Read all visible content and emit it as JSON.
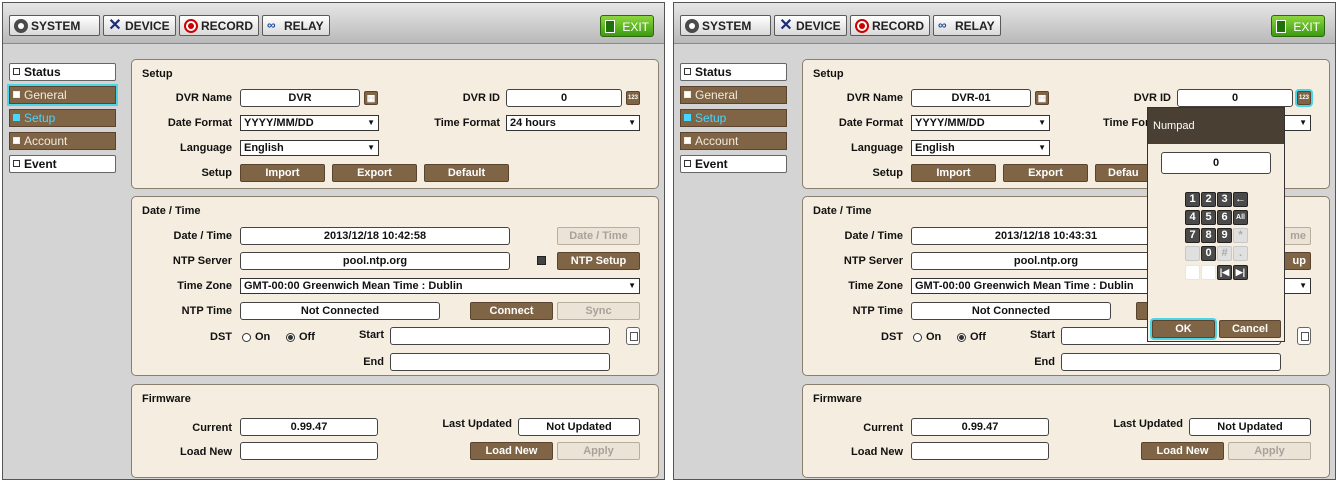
{
  "menu": {
    "system": "SYSTEM",
    "device": "DEVICE",
    "record": "RECORD",
    "relay": "RELAY",
    "exit": "EXIT"
  },
  "sidebar": {
    "status": "Status",
    "general": "General",
    "setup": "Setup",
    "account": "Account",
    "event": "Event"
  },
  "setup": {
    "title": "Setup",
    "dvr_name_label": "DVR Name",
    "dvr_id_label": "DVR ID",
    "date_format_label": "Date Format",
    "date_format_value": "YYYY/MM/DD",
    "time_format_label": "Time Format",
    "time_format_value": "24 hours",
    "language_label": "Language",
    "language_value": "English",
    "setup_label": "Setup",
    "import_button": "Import",
    "export_button": "Export",
    "default_button": "Default",
    "keyboard_icon_text": "123"
  },
  "datetime": {
    "title": "Date / Time",
    "date_time_label": "Date / Time",
    "date_time_button": "Date / Time",
    "ntp_server_label": "NTP Server",
    "ntp_server_value": "pool.ntp.org",
    "ntp_setup_button": "NTP Setup",
    "time_zone_label": "Time Zone",
    "time_zone_value": "GMT-00:00 Greenwich Mean Time : Dublin",
    "ntp_time_label": "NTP Time",
    "ntp_time_value": "Not Connected",
    "connect_button": "Connect",
    "sync_button": "Sync",
    "dst_label": "DST",
    "dst_on": "On",
    "dst_off": "Off",
    "start_label": "Start",
    "end_label": "End"
  },
  "firmware": {
    "title": "Firmware",
    "current_label": "Current",
    "current_value": "0.99.47",
    "last_updated_label": "Last Updated",
    "last_updated_value": "Not Updated",
    "load_new_label": "Load New",
    "load_new_button": "Load New",
    "apply_button": "Apply"
  },
  "left": {
    "dvr_name": "DVR",
    "dvr_id": "0",
    "date_time": "2013/12/18  10:42:58"
  },
  "right": {
    "dvr_name": "DVR-01",
    "dvr_id": "0",
    "date_time": "2013/12/18  10:43:31",
    "time_format_partial": "Time For",
    "default_partial": "Defau"
  },
  "numpad": {
    "title": "Numpad",
    "value": "0",
    "keys": [
      "1",
      "2",
      "3",
      "4",
      "5",
      "6",
      "7",
      "8",
      "9",
      "*",
      "0",
      "#",
      "."
    ],
    "backspace": "←",
    "all": "All",
    "ok": "OK",
    "cancel": "Cancel"
  },
  "colors": {
    "accent_brown": "#7f6446",
    "panel_bg": "#f5eddf",
    "highlight_cyan": "#4ad6e6",
    "exit_green": "#3c9a12"
  }
}
